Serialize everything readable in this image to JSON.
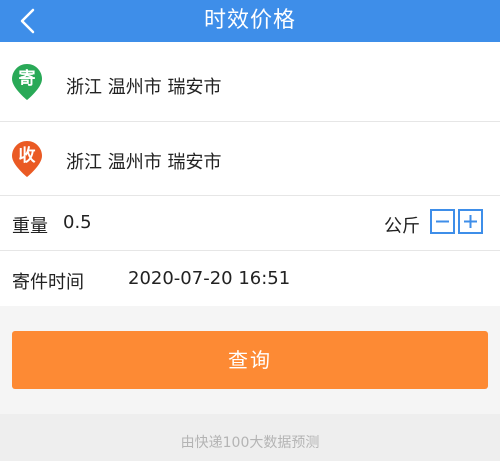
{
  "header": {
    "title": "时效价格",
    "back_icon": "chevron-left-icon"
  },
  "sender": {
    "icon": "pin-send-icon",
    "icon_label": "寄",
    "icon_color": "#29a957",
    "address": "浙江  温州市  瑞安市"
  },
  "receiver": {
    "icon": "pin-receive-icon",
    "icon_label": "收",
    "icon_color": "#ea5a24",
    "address": "浙江  温州市  瑞安市"
  },
  "weight": {
    "label": "重量",
    "value": "0.5",
    "unit": "公斤",
    "decrease_icon": "minus-icon",
    "increase_icon": "plus-icon"
  },
  "send_time": {
    "label": "寄件时间",
    "value": "2020-07-20 16:51"
  },
  "query_button": {
    "label": "查询"
  },
  "footer": {
    "note": "由快递100大数据预测"
  },
  "colors": {
    "header": "#3e8ee9",
    "button": "#fd8a34"
  }
}
